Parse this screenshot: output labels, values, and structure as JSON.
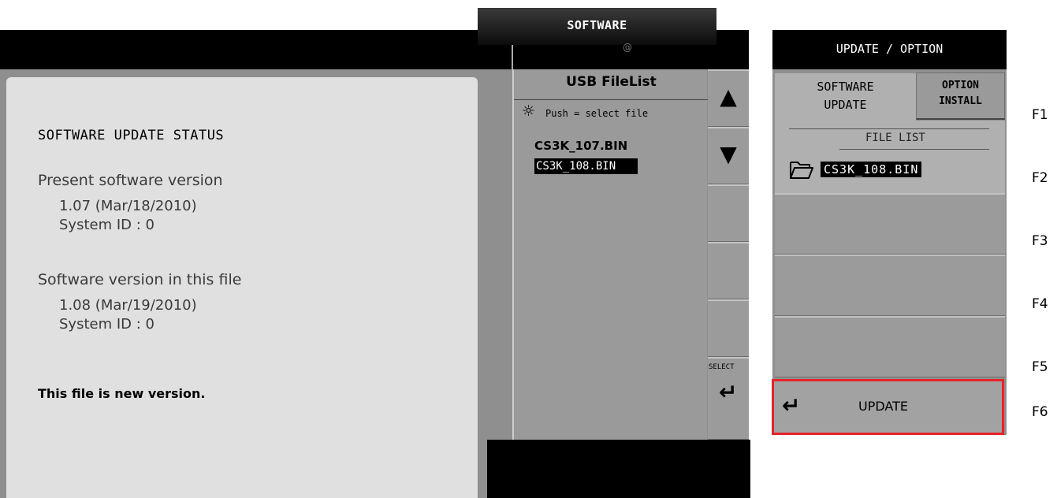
{
  "software_tab": {
    "label": "SOFTWARE",
    "sub_icon": "@"
  },
  "status": {
    "title": "SOFTWARE UPDATE STATUS",
    "present_label": "Present software version",
    "present_version": "1.07 (Mar/18/2010)",
    "present_system_id": "System ID : 0",
    "file_label": "Software version in this file",
    "file_version": "1.08 (Mar/19/2010)",
    "file_system_id": "System ID : 0",
    "message": "This file is new version."
  },
  "usb_filelist": {
    "header": "USB FileList",
    "hint": "Push = select file",
    "hint_icon": "knob-icon",
    "files": [
      "CS3K_107.BIN",
      "CS3K_108.BIN"
    ],
    "selected_index": 1
  },
  "side_buttons": {
    "up_icon": "▲",
    "down_icon": "▼",
    "select_label": "SELECT",
    "select_icon": "↵"
  },
  "right_panel": {
    "header": "UPDATE / OPTION",
    "tab_software_line1": "SOFTWARE",
    "tab_software_line2": "UPDATE",
    "tab_option_line1": "OPTION",
    "tab_option_line2": "INSTALL",
    "file_list_title": "FILE LIST",
    "selected_file": "CS3K_108.BIN",
    "update_label": "UPDATE",
    "highlight_color": "#e8222a"
  },
  "function_keys": [
    "F1",
    "F2",
    "F3",
    "F4",
    "F5",
    "F6"
  ]
}
